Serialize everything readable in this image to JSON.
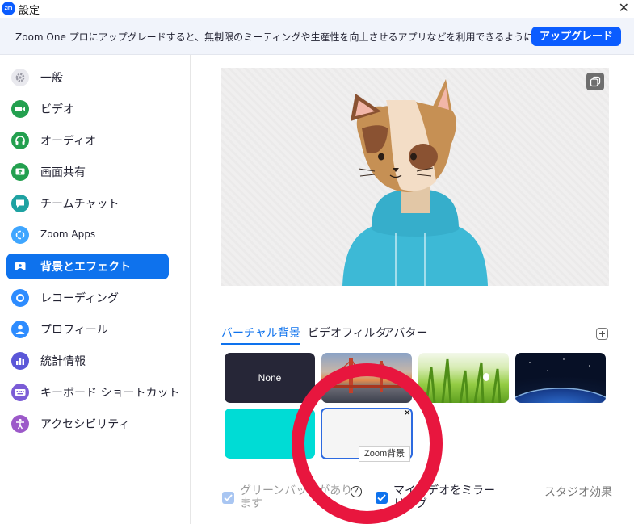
{
  "window": {
    "title": "設定",
    "logo_text": "zm",
    "close_glyph": "✕"
  },
  "banner": {
    "text": "Zoom One プロにアップグレードすると、無制限のミーティングや生産性を向上させるアプリなどを利用できるようになり...",
    "button": "アップグレード"
  },
  "sidebar": {
    "items": [
      {
        "label": "一般",
        "icon": "gear-icon",
        "color": "#e8e8ec",
        "active": false
      },
      {
        "label": "ビデオ",
        "icon": "video-camera-icon",
        "color": "#23a04f",
        "active": false
      },
      {
        "label": "オーディオ",
        "icon": "headphones-icon",
        "color": "#23a04f",
        "active": false
      },
      {
        "label": "画面共有",
        "icon": "share-screen-icon",
        "color": "#23a04f",
        "active": false
      },
      {
        "label": "チームチャット",
        "icon": "chat-bubble-icon",
        "color": "#1ea2a2",
        "active": false
      },
      {
        "label": "Zoom Apps",
        "icon": "apps-icon",
        "color": "#3fa6ff",
        "active": false
      },
      {
        "label": "背景とエフェクト",
        "icon": "background-icon",
        "color": "#ffffff",
        "active": true
      },
      {
        "label": "レコーディング",
        "icon": "record-icon",
        "color": "#2d8cff",
        "active": false
      },
      {
        "label": "プロフィール",
        "icon": "person-icon",
        "color": "#2d8cff",
        "active": false
      },
      {
        "label": "統計情報",
        "icon": "bar-chart-icon",
        "color": "#5b57d8",
        "active": false
      },
      {
        "label": "キーボード ショートカット",
        "icon": "keyboard-icon",
        "color": "#7b5cd6",
        "active": false
      },
      {
        "label": "アクセシビリティ",
        "icon": "accessibility-icon",
        "color": "#9c59c9",
        "active": false
      }
    ]
  },
  "main": {
    "tabs": [
      {
        "label": "バーチャル背景",
        "active": true
      },
      {
        "label": "ビデオフィルタ",
        "active": false
      },
      {
        "label": "アバター",
        "active": false
      }
    ],
    "backgrounds": {
      "none_label": "None",
      "tooltip": "Zoom背景",
      "remove_glyph": "×"
    },
    "options": {
      "green_screen": "グリーンバックがあります",
      "mirror_video": "マイビデオをミラーリング",
      "studio_effects": "スタジオ効果",
      "help_glyph": "?"
    }
  },
  "colors": {
    "accent": "#0e72ed",
    "annotation": "#e8163e"
  }
}
